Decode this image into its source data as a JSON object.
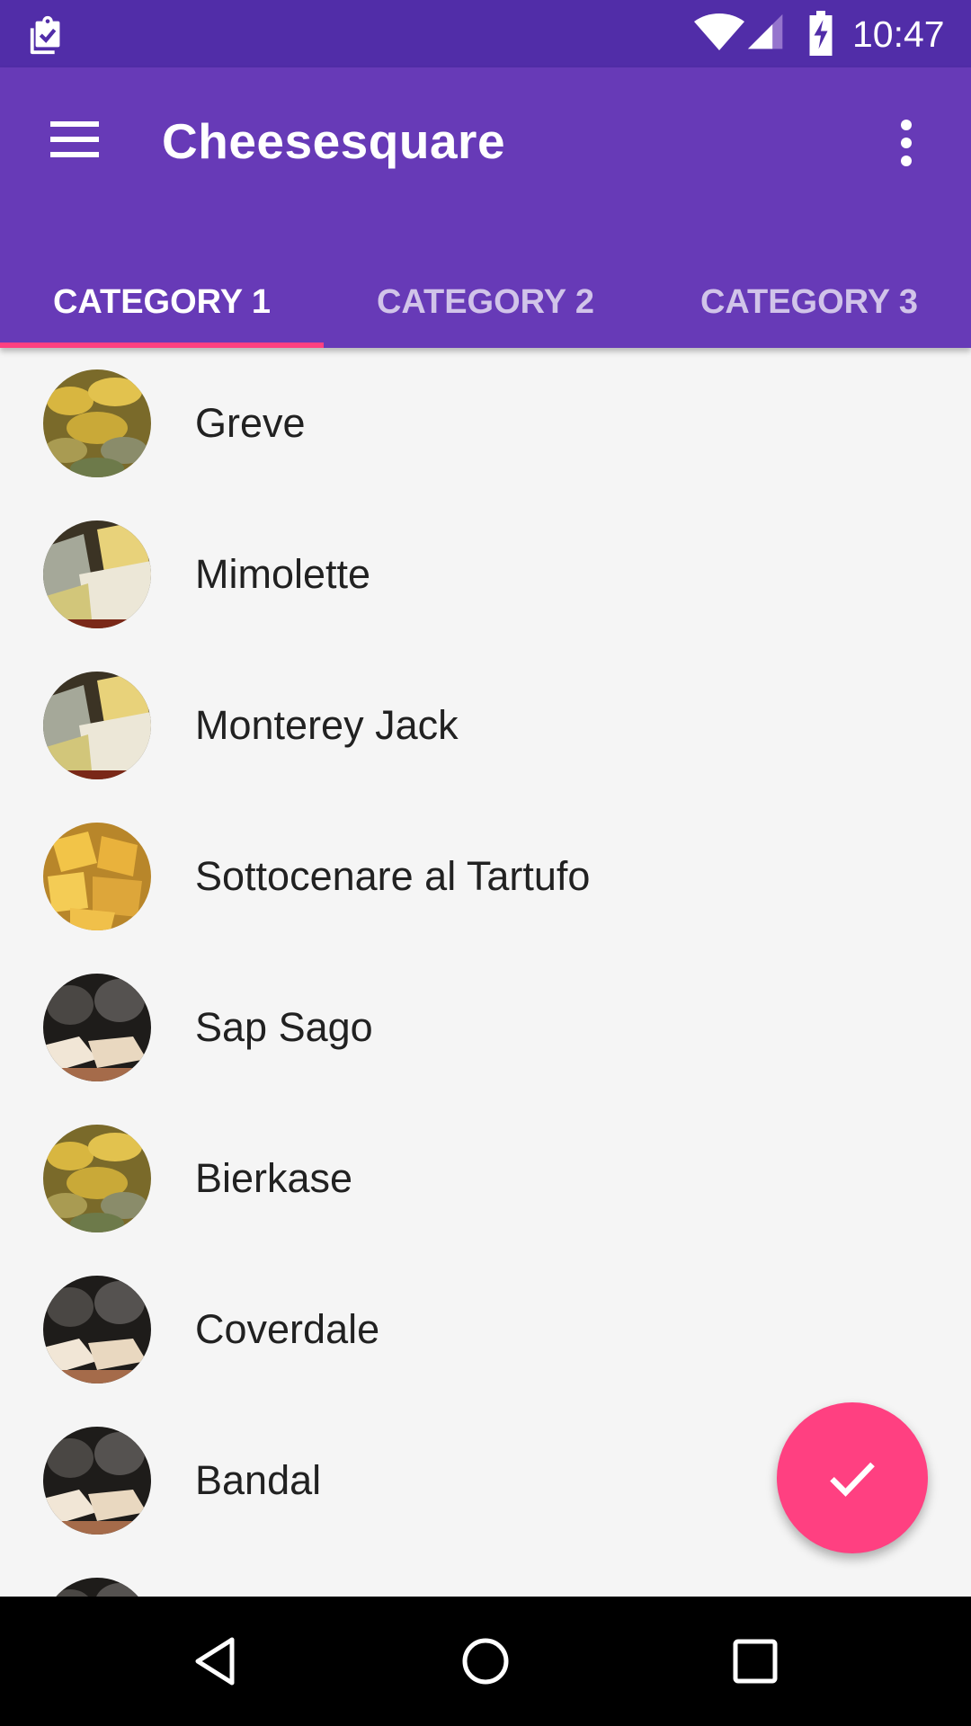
{
  "status_bar": {
    "time": "10:47",
    "icons": [
      "clipboard-check-icon",
      "wifi-icon",
      "cell-signal-icon",
      "battery-charging-icon"
    ]
  },
  "app_bar": {
    "title": "Cheesesquare",
    "menu_icon": "hamburger-menu-icon",
    "overflow_icon": "more-vert-icon"
  },
  "tabs": [
    {
      "label": "CATEGORY 1",
      "selected": true
    },
    {
      "label": "CATEGORY 2",
      "selected": false
    },
    {
      "label": "CATEGORY 3",
      "selected": false
    }
  ],
  "list": {
    "items": [
      {
        "name": "Greve",
        "avatar": "wheels"
      },
      {
        "name": "Mimolette",
        "avatar": "wedges"
      },
      {
        "name": "Monterey Jack",
        "avatar": "wedges"
      },
      {
        "name": "Sottocenare al Tartufo",
        "avatar": "cubes"
      },
      {
        "name": "Sap Sago",
        "avatar": "dark"
      },
      {
        "name": "Bierkase",
        "avatar": "wheels"
      },
      {
        "name": "Coverdale",
        "avatar": "dark"
      },
      {
        "name": "Bandal",
        "avatar": "dark"
      }
    ]
  },
  "fab": {
    "icon": "check-icon"
  },
  "colors": {
    "status_bar": "#512da8",
    "primary": "#673ab7",
    "accent": "#ff4081",
    "background": "#f5f5f5",
    "text": "#212121"
  },
  "nav_bar": {
    "icons": [
      "back-icon",
      "home-icon",
      "recents-icon"
    ]
  }
}
